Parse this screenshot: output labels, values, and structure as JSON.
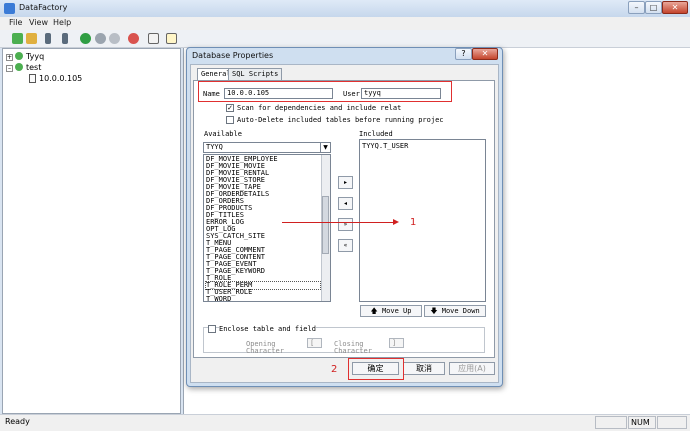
{
  "window": {
    "title": "DataFactory",
    "min": "–",
    "max": "□",
    "close": "✕"
  },
  "menu": [
    "File",
    "View",
    "Help"
  ],
  "tree": [
    {
      "label": "Tyyq",
      "expander": "+"
    },
    {
      "label": "test",
      "expander": "–"
    },
    {
      "label": "10.0.0.105",
      "expander": ""
    }
  ],
  "status": {
    "text": "Ready",
    "num": "NUM"
  },
  "dialog": {
    "title": "Database Properties",
    "help": "?",
    "close": "✕",
    "tabs": [
      "General",
      "SQL Scripts"
    ],
    "name_label": "Name",
    "name_value": "10.0.0.105",
    "user_label": "User",
    "user_value": "tyyq",
    "scan_checked": "✓",
    "scan_label": "Scan for dependencies and include relat",
    "autodelete_label": "Auto-Delete included tables before running projec",
    "available_label": "Available",
    "available_selected": "TYYQ",
    "available_items": [
      "DF_MOVIE_EMPLOYEE",
      "DF_MOVIE_MOVIE",
      "DF_MOVIE_RENTAL",
      "DF_MOVIE_STORE",
      "DF_MOVIE_TAPE",
      "DF_ORDERDETAILS",
      "DF_ORDERS",
      "DF_PRODUCTS",
      "DF_TITLES",
      "ERROR_LOG",
      "OPT_LOG",
      "SYS_CATCH_SITE",
      "T_MENU",
      "T_PAGE_COMMENT",
      "T_PAGE_CONTENT",
      "T_PAGE_EVENT",
      "T_PAGE_KEYWORD",
      "T_ROLE",
      "T_ROLE_PERM",
      "T_USER_ROLE",
      "T_WORD"
    ],
    "included_label": "Included",
    "included_items": [
      "TYYQ.T_USER"
    ],
    "arrow_buttons": [
      "▸",
      "◂",
      "»",
      "«"
    ],
    "move_up": "Move Up",
    "move_down": "Move Down",
    "enclose_label": "Enclose table and field",
    "opening_label": "Opening",
    "opening_value": "[",
    "closing_label": "Closing",
    "closing_value": "]",
    "char_label": "Character",
    "ok": "确定",
    "cancel": "取消",
    "apply": "应用(A)"
  },
  "annotations": {
    "one": "1",
    "two": "2"
  },
  "colors": {
    "highlight": "#e03030",
    "annotation": "#d02020"
  }
}
